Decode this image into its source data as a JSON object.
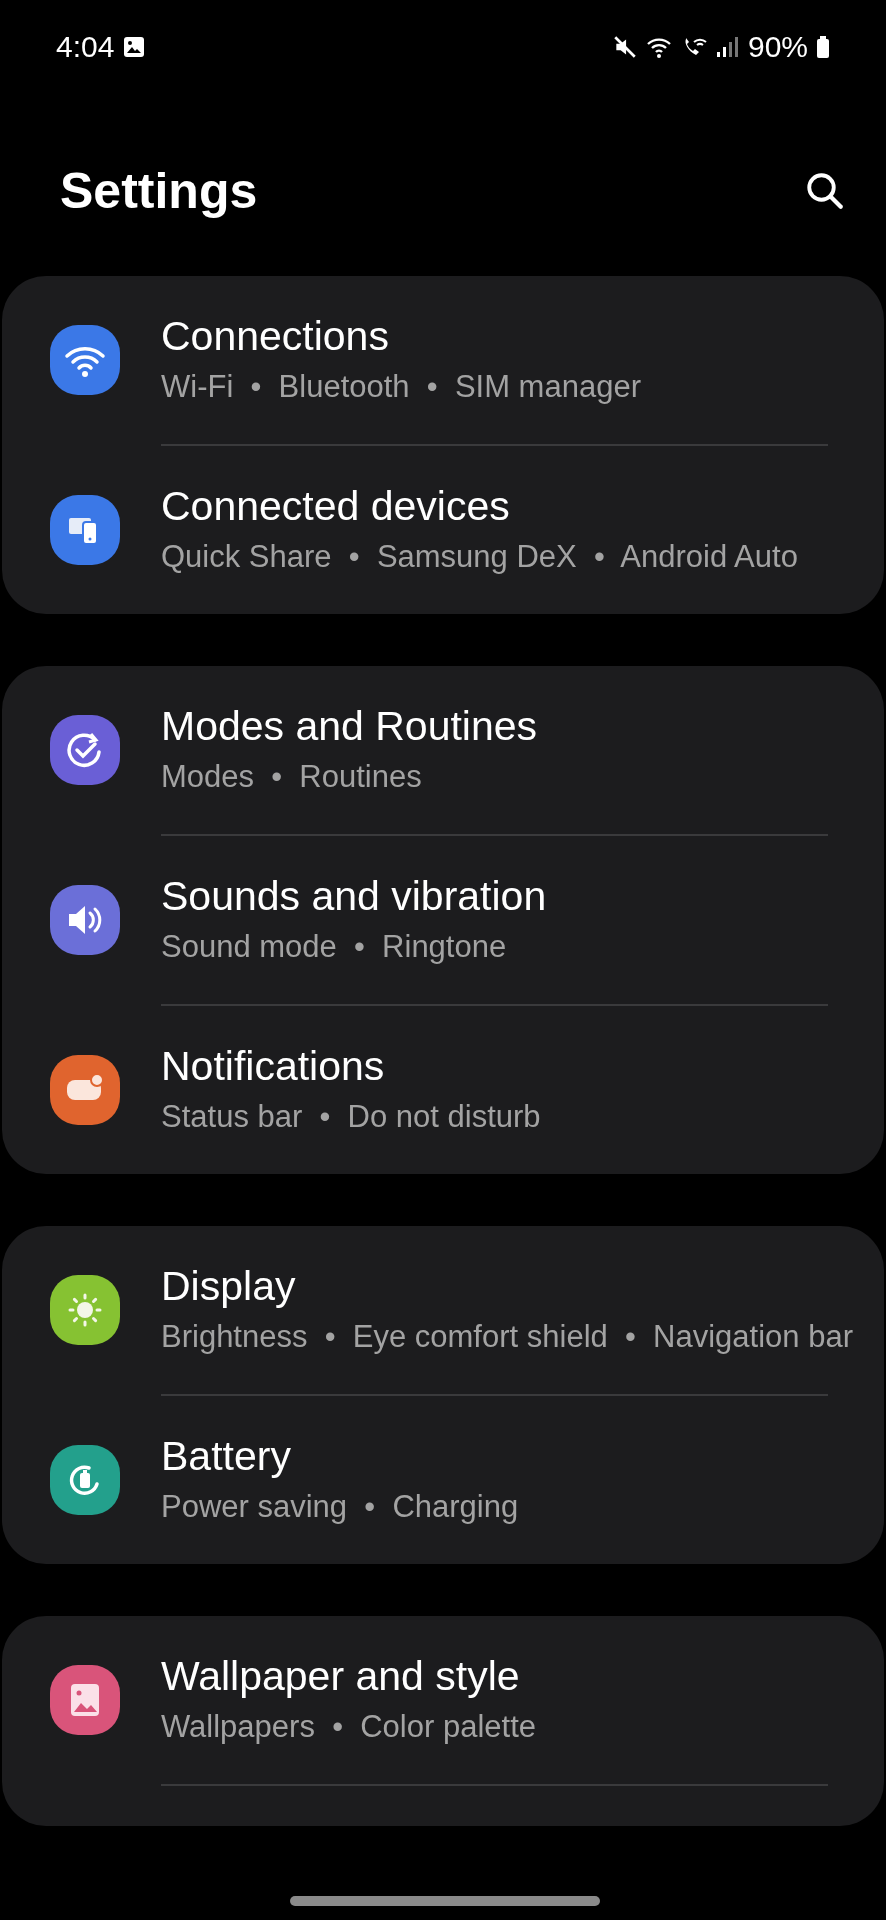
{
  "status_bar": {
    "time": "4:04",
    "battery": "90%"
  },
  "header": {
    "title": "Settings"
  },
  "groups": [
    {
      "items": [
        {
          "kind": "wifi",
          "color": "#3b78e7",
          "title": "Connections",
          "subtitle": "Wi-Fi  •  Bluetooth  •  SIM manager"
        },
        {
          "kind": "devices",
          "color": "#3b78e7",
          "title": "Connected devices",
          "subtitle": "Quick Share  •  Samsung DeX  •  Android Auto"
        }
      ]
    },
    {
      "items": [
        {
          "kind": "modes",
          "color": "#6a5fd6",
          "title": "Modes and Routines",
          "subtitle": "Modes  •  Routines"
        },
        {
          "kind": "sound",
          "color": "#6b6fd8",
          "title": "Sounds and vibration",
          "subtitle": "Sound mode  •  Ringtone"
        },
        {
          "kind": "notifications",
          "color": "#e0642e",
          "title": "Notifications",
          "subtitle": "Status bar  •  Do not disturb"
        }
      ]
    },
    {
      "items": [
        {
          "kind": "display",
          "color": "#86c232",
          "title": "Display",
          "subtitle": "Brightness  •  Eye comfort shield  •  Navigation bar"
        },
        {
          "kind": "battery",
          "color": "#23a08c",
          "title": "Battery",
          "subtitle": "Power saving  •  Charging"
        }
      ]
    },
    {
      "items": [
        {
          "kind": "wallpaper",
          "color": "#d9547a",
          "title": "Wallpaper and style",
          "subtitle": "Wallpapers  •  Color palette"
        }
      ]
    }
  ]
}
